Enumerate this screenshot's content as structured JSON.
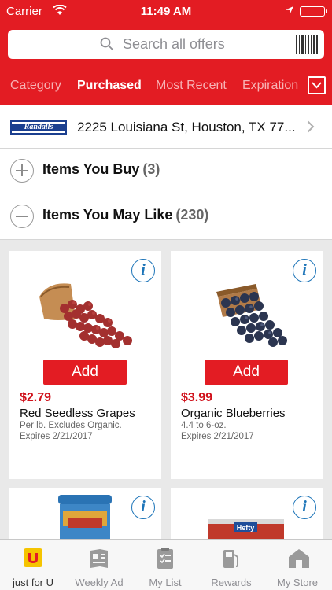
{
  "status_bar": {
    "carrier": "Carrier",
    "time": "11:49 AM"
  },
  "search": {
    "placeholder": "Search all offers",
    "icon": "search-icon",
    "scan_icon": "barcode-icon"
  },
  "filters": {
    "tabs": [
      {
        "label": "Category",
        "active": false
      },
      {
        "label": "Purchased",
        "active": true
      },
      {
        "label": "Most Recent",
        "active": false
      },
      {
        "label": "Expiration",
        "active": false
      }
    ],
    "dropdown_icon": "chevron-down-icon"
  },
  "store": {
    "logo_text": "Randalls",
    "address": "2225 Louisiana St, Houston, TX 77..."
  },
  "sections": [
    {
      "title": "Items You Buy",
      "count": "(3)",
      "expanded": false
    },
    {
      "title": "Items You May Like",
      "count": "(230)",
      "expanded": true
    }
  ],
  "offers": [
    {
      "add_label": "Add",
      "price": "$2.79",
      "name": "Red Seedless Grapes",
      "desc": "Per lb. Excludes Organic.",
      "expires": "Expires 2/21/2017",
      "image": "grapes-image"
    },
    {
      "add_label": "Add",
      "price": "$3.99",
      "name": "Organic Blueberries",
      "desc": "4.4 to 6-oz.",
      "expires": "Expires 2/21/2017",
      "image": "blueberries-image"
    },
    {
      "image": "peanut-butter-image"
    },
    {
      "image": "hefty-bags-image",
      "brand": "Hefty"
    }
  ],
  "tabbar": [
    {
      "label": "just for U",
      "icon": "just-for-u-icon",
      "active": true
    },
    {
      "label": "Weekly Ad",
      "icon": "weekly-ad-icon",
      "active": false
    },
    {
      "label": "My List",
      "icon": "list-icon",
      "active": false
    },
    {
      "label": "Rewards",
      "icon": "fuel-pump-icon",
      "active": false
    },
    {
      "label": "My Store",
      "icon": "store-icon",
      "active": false
    }
  ],
  "colors": {
    "brand_red": "#e31c23",
    "price_red": "#d0111b",
    "info_blue": "#1c74b8",
    "logo_blue": "#1b3f8f"
  }
}
